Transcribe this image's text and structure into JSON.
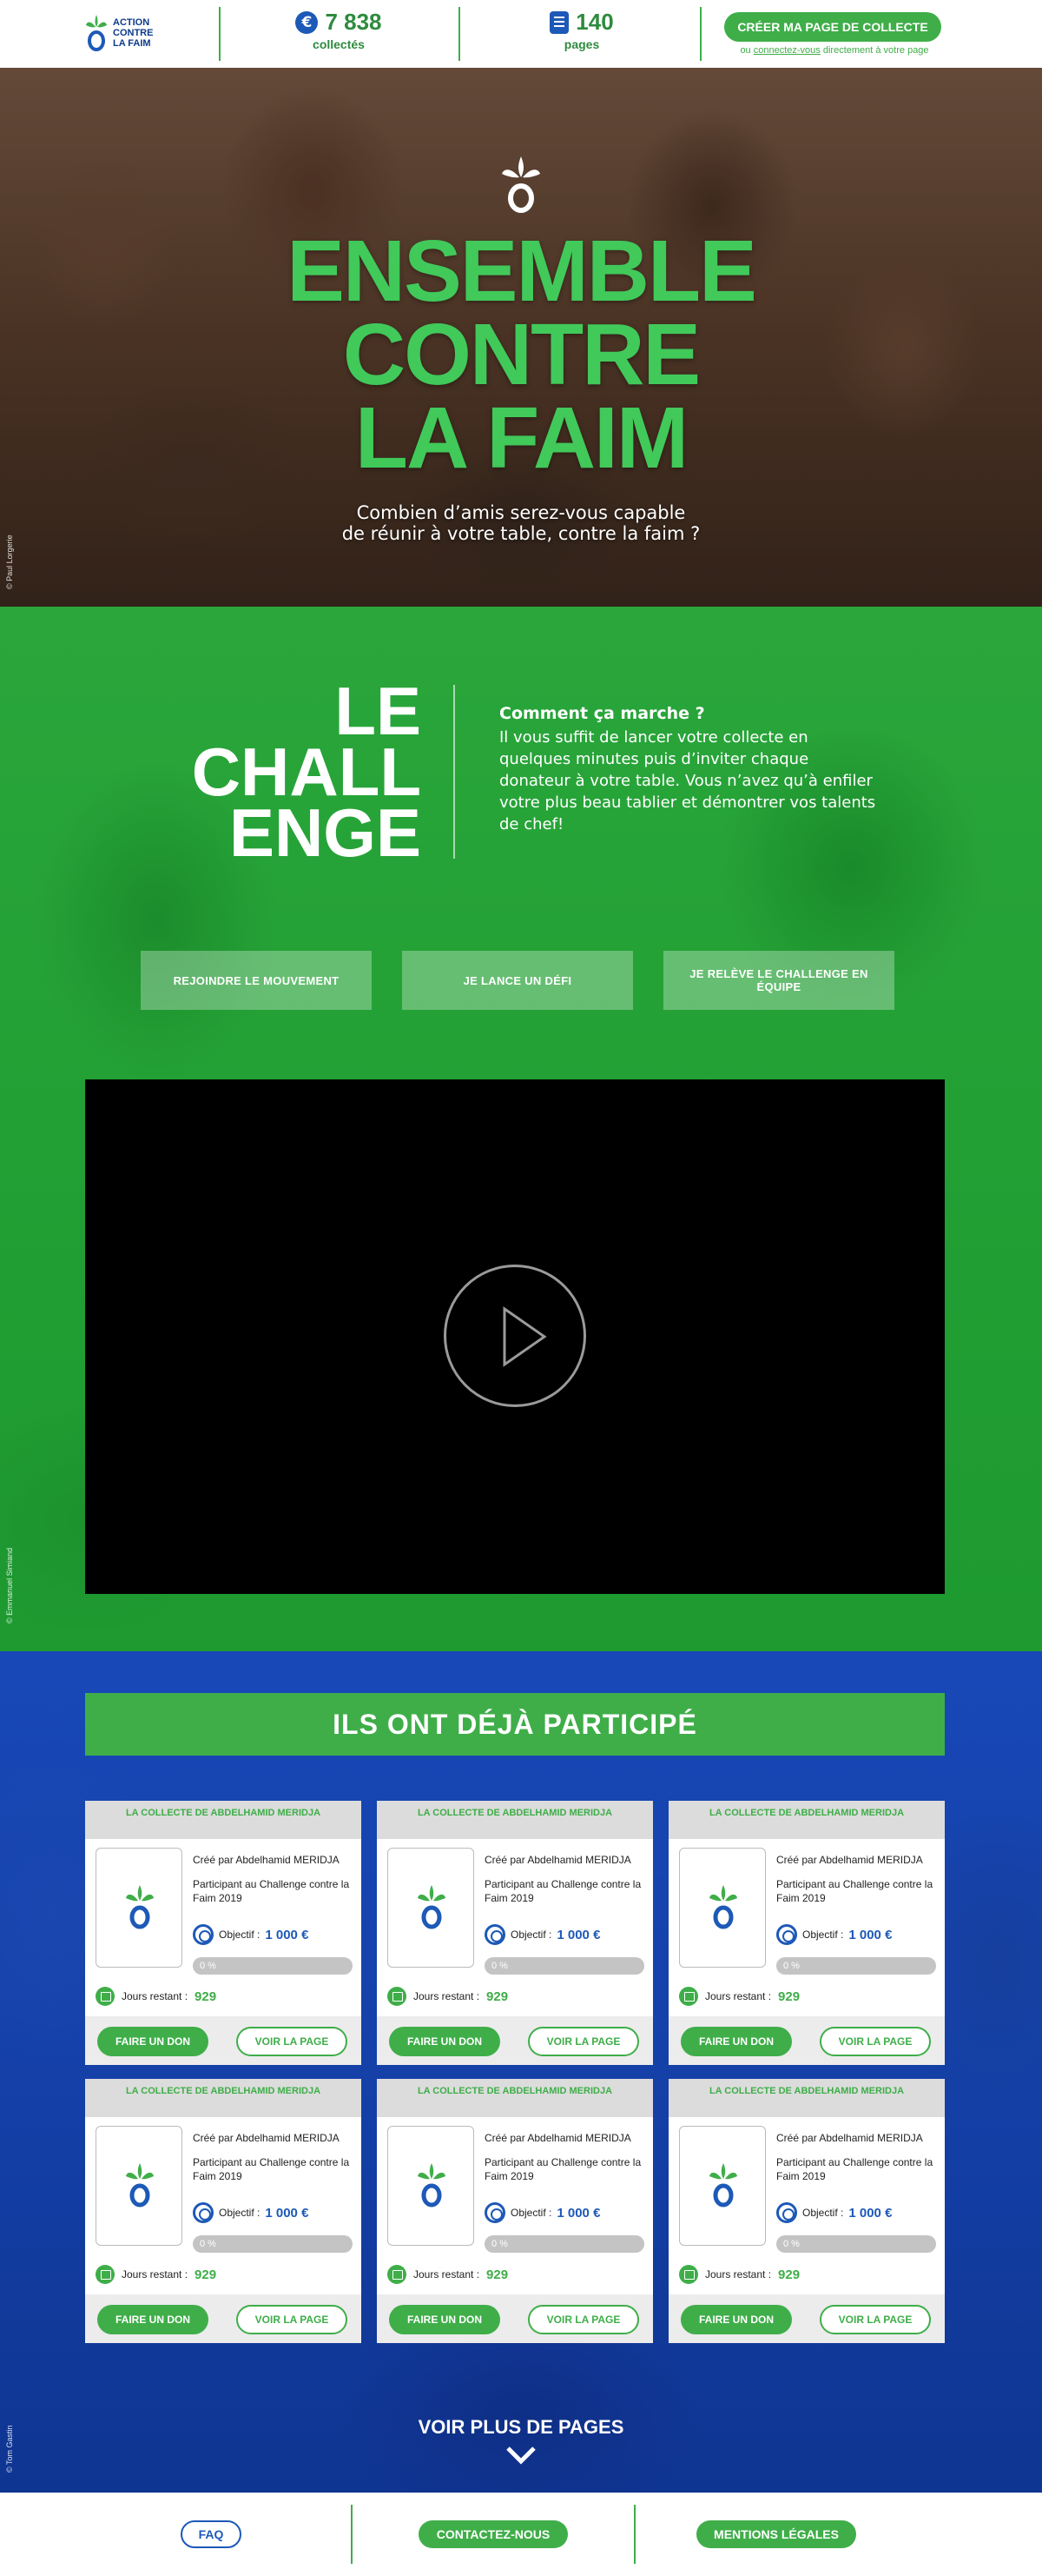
{
  "header": {
    "logo_lines": [
      "ACTION",
      "CONTRE",
      "LA FAIM"
    ],
    "stats": [
      {
        "icon": "euro-icon",
        "value": "7 838",
        "label": "collectés"
      },
      {
        "icon": "page-icon",
        "value": "140",
        "label": "pages"
      }
    ],
    "create_button": "CRÉER MA PAGE DE COLLECTE",
    "create_sub_prefix": "ou",
    "create_sub_link": "connectez-vous",
    "create_sub_suffix": "directement à votre page"
  },
  "hero": {
    "title_lines": [
      "ENSEMBLE",
      "CONTRE",
      "LA FAIM"
    ],
    "subtitle_line1": "Combien d’amis serez-vous capable",
    "subtitle_line2": "de réunir à votre table, contre la faim ?",
    "photo_credit": "© Paul Lorgerie"
  },
  "challenge": {
    "title_lines": [
      "LE",
      "CHALL",
      "ENGE"
    ],
    "how_title": "Comment ça marche ?",
    "how_text": "Il vous suffit de lancer votre collecte en quelques minutes puis d’inviter chaque donateur à votre table. Vous n’avez qu’à enfiler votre plus beau tablier et démontrer vos talents de chef!",
    "buttons": [
      "REJOINDRE LE MOUVEMENT",
      "JE LANCE UN DÉFI",
      "JE RELÈVE LE CHALLENGE EN ÉQUIPE"
    ],
    "photo_credit": "© Emmanuel Simiand"
  },
  "participants": {
    "banner": "ILS ONT DÉJÀ PARTICIPÉ",
    "cards": [
      {
        "title": "LA COLLECTE DE ABDELHAMID MERIDJA",
        "creator": "Créé par Abdelhamid MERIDJA",
        "desc": "Participant au Challenge contre la Faim 2019",
        "objective_label": "Objectif :",
        "objective": "1 000 €",
        "progress": "0 %",
        "progress_value": 0,
        "days_label": "Jours restant :",
        "days": "929",
        "donate": "FAIRE UN DON",
        "view": "VOIR LA PAGE"
      },
      {
        "title": "LA COLLECTE DE ABDELHAMID MERIDJA",
        "creator": "Créé par Abdelhamid MERIDJA",
        "desc": "Participant au Challenge contre la Faim 2019",
        "objective_label": "Objectif :",
        "objective": "1 000 €",
        "progress": "0 %",
        "progress_value": 0,
        "days_label": "Jours restant :",
        "days": "929",
        "donate": "FAIRE UN DON",
        "view": "VOIR LA PAGE"
      },
      {
        "title": "LA COLLECTE DE ABDELHAMID MERIDJA",
        "creator": "Créé par Abdelhamid MERIDJA",
        "desc": "Participant au Challenge contre la Faim 2019",
        "objective_label": "Objectif :",
        "objective": "1 000 €",
        "progress": "0 %",
        "progress_value": 0,
        "days_label": "Jours restant :",
        "days": "929",
        "donate": "FAIRE UN DON",
        "view": "VOIR LA PAGE"
      },
      {
        "title": "LA COLLECTE DE ABDELHAMID MERIDJA",
        "creator": "Créé par Abdelhamid MERIDJA",
        "desc": "Participant au Challenge contre la Faim 2019",
        "objective_label": "Objectif :",
        "objective": "1 000 €",
        "progress": "0 %",
        "progress_value": 0,
        "days_label": "Jours restant :",
        "days": "929",
        "donate": "FAIRE UN DON",
        "view": "VOIR LA PAGE"
      },
      {
        "title": "LA COLLECTE DE ABDELHAMID MERIDJA",
        "creator": "Créé par Abdelhamid MERIDJA",
        "desc": "Participant au Challenge contre la Faim 2019",
        "objective_label": "Objectif :",
        "objective": "1 000 €",
        "progress": "0 %",
        "progress_value": 0,
        "days_label": "Jours restant :",
        "days": "929",
        "donate": "FAIRE UN DON",
        "view": "VOIR LA PAGE"
      },
      {
        "title": "LA COLLECTE DE ABDELHAMID MERIDJA",
        "creator": "Créé par Abdelhamid MERIDJA",
        "desc": "Participant au Challenge contre la Faim 2019",
        "objective_label": "Objectif :",
        "objective": "1 000 €",
        "progress": "0 %",
        "progress_value": 0,
        "days_label": "Jours restant :",
        "days": "929",
        "donate": "FAIRE UN DON",
        "view": "VOIR LA PAGE"
      }
    ],
    "more": "VOIR PLUS DE PAGES",
    "photo_credit": "© Tom Gastin"
  },
  "footer": {
    "faq": "FAQ",
    "contact": "CONTACTEZ-NOUS",
    "legal": "MENTIONS LÉGALES"
  },
  "colors": {
    "brand_green": "#3fae49",
    "brand_blue": "#1d59b7",
    "hero_title_green": "#41c95a"
  }
}
